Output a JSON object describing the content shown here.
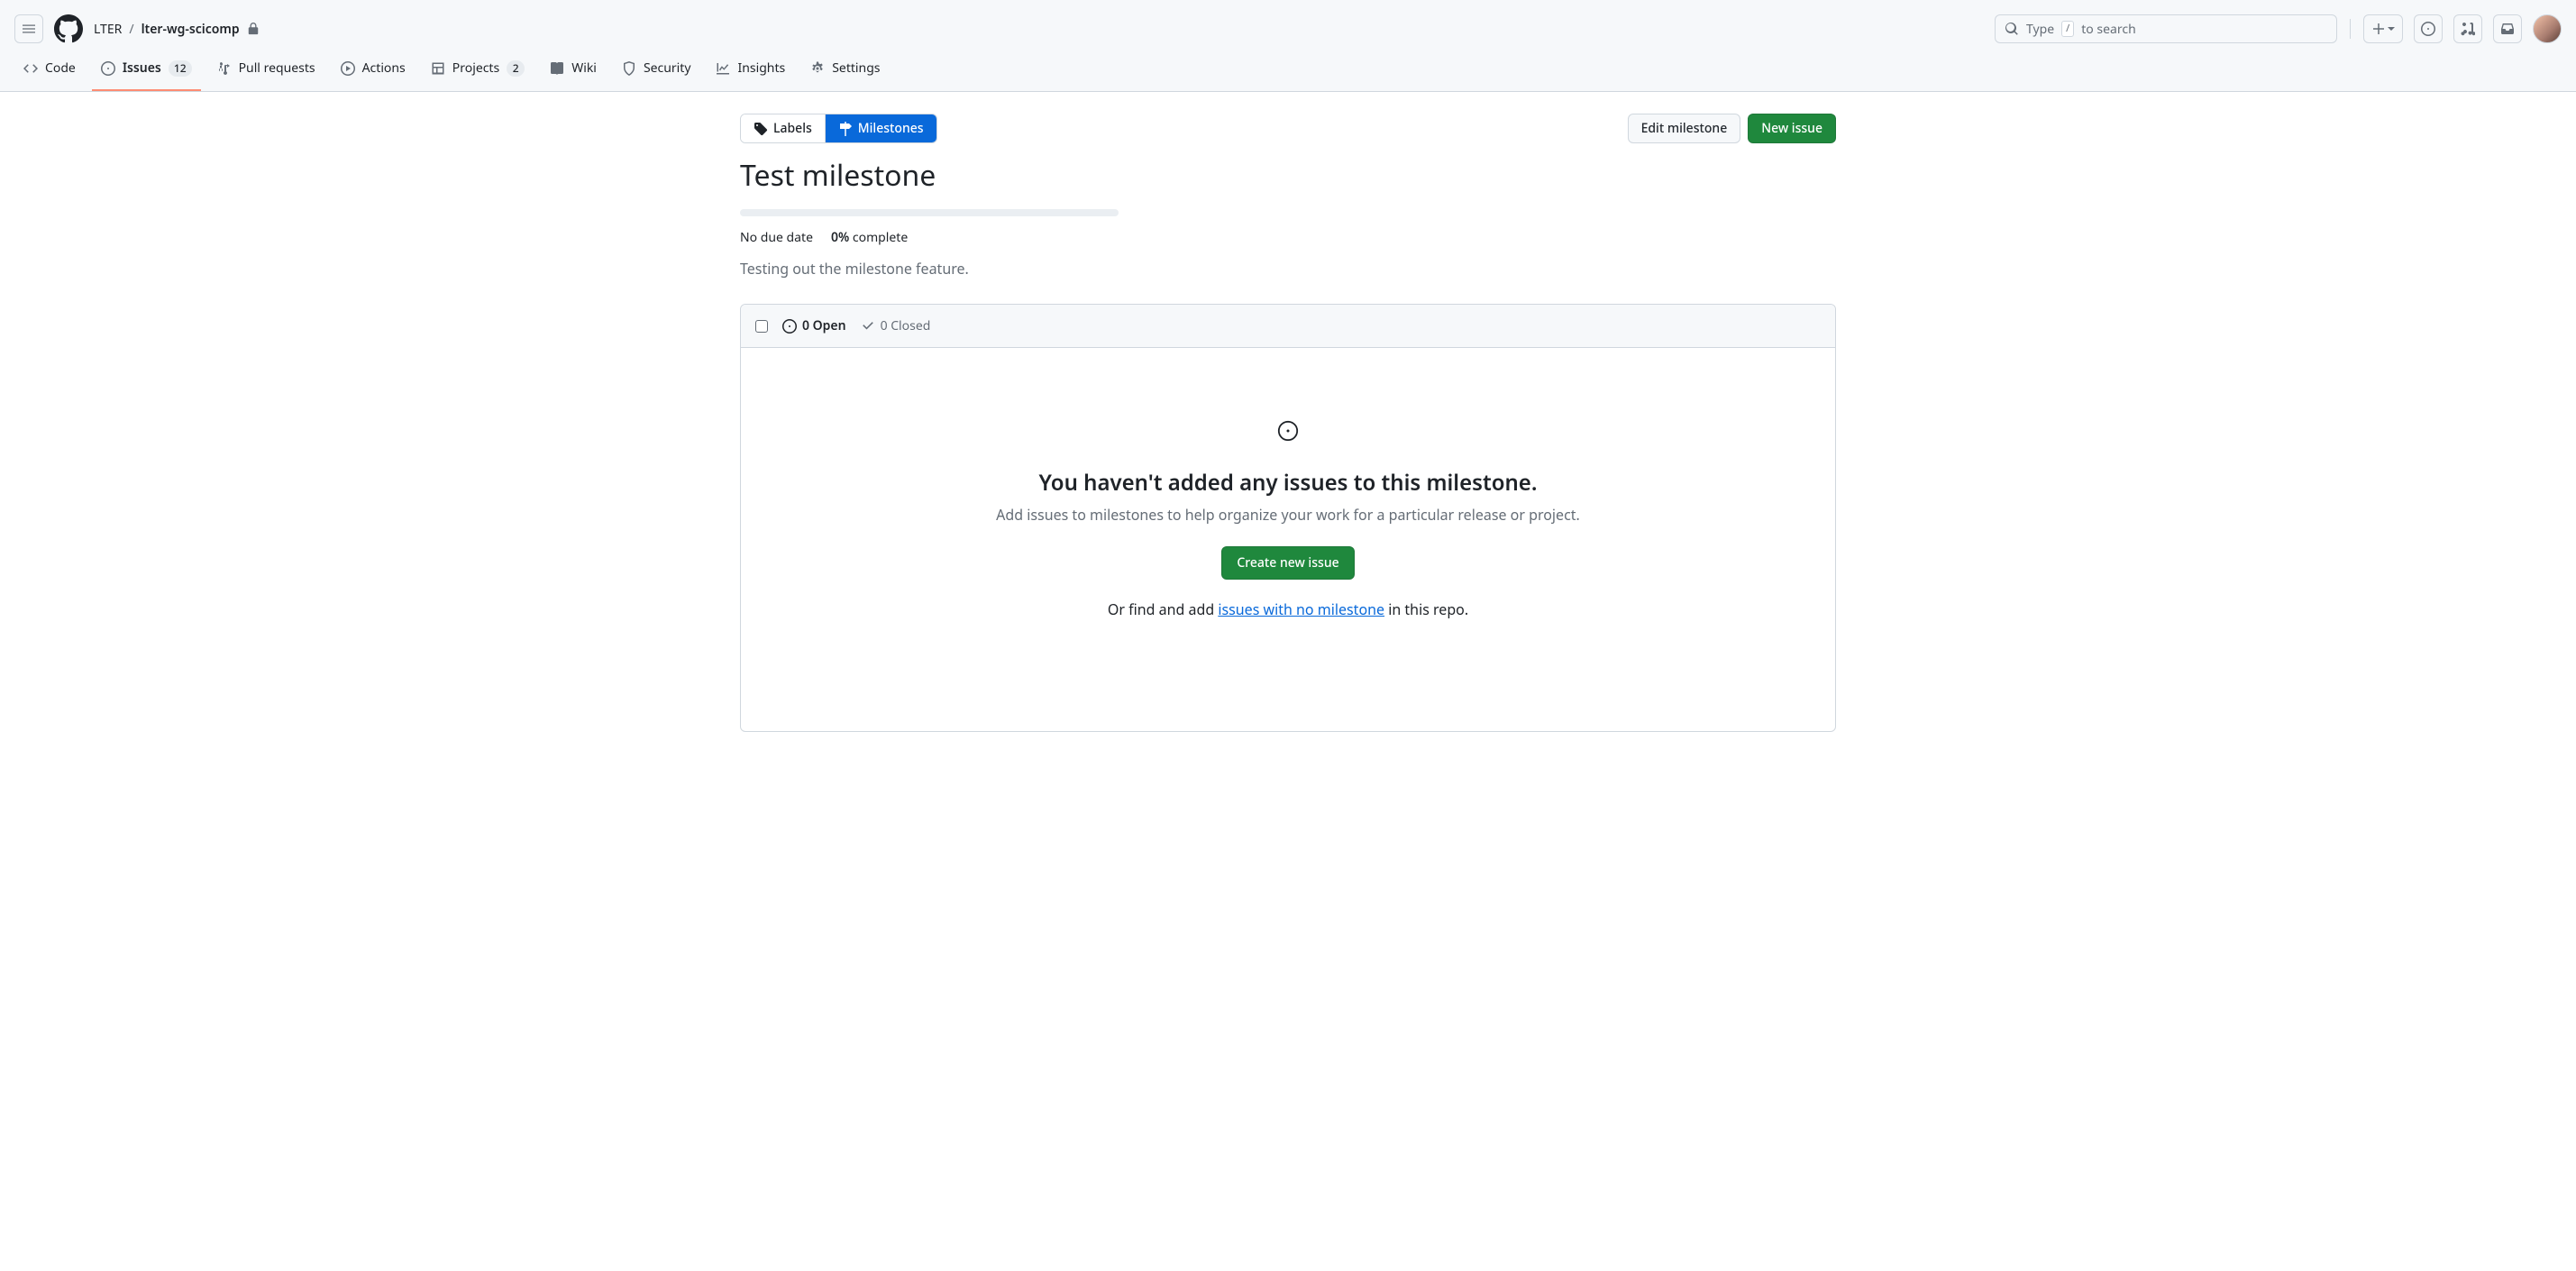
{
  "header": {
    "owner": "LTER",
    "repo": "lter-wg-scicomp",
    "search_prefix": "Type",
    "search_key": "/",
    "search_suffix": "to search"
  },
  "tabs": {
    "code": "Code",
    "issues": {
      "label": "Issues",
      "count": "12"
    },
    "pull_requests": "Pull requests",
    "actions": "Actions",
    "projects": {
      "label": "Projects",
      "count": "2"
    },
    "wiki": "Wiki",
    "security": "Security",
    "insights": "Insights",
    "settings": "Settings"
  },
  "subnav": {
    "labels": "Labels",
    "milestones": "Milestones",
    "edit_milestone": "Edit milestone",
    "new_issue": "New issue"
  },
  "milestone": {
    "title": "Test milestone",
    "due": "No due date",
    "percent": "0%",
    "complete_word": "complete",
    "description": "Testing out the milestone feature."
  },
  "issue_box": {
    "open": "0 Open",
    "closed": "0 Closed"
  },
  "blankslate": {
    "heading": "You haven't added any issues to this milestone.",
    "sub": "Add issues to milestones to help organize your work for a particular release or project.",
    "create_btn": "Create new issue",
    "trail_before": "Or find and add ",
    "trail_link": "issues with no milestone",
    "trail_after": " in this repo."
  }
}
